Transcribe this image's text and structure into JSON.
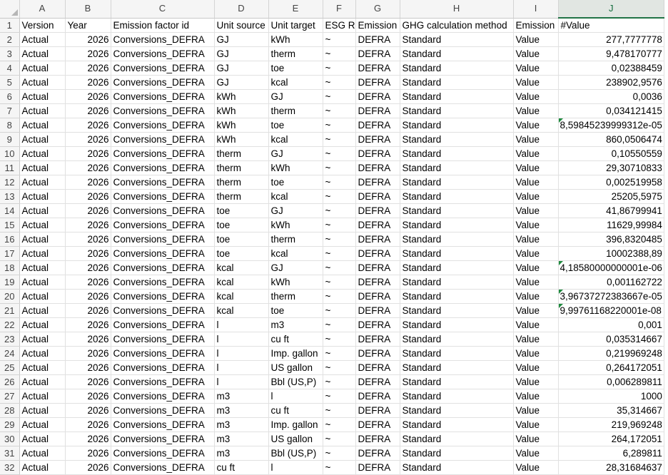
{
  "columns": [
    "A",
    "B",
    "C",
    "D",
    "E",
    "F",
    "G",
    "H",
    "I",
    "J"
  ],
  "active_column": "J",
  "rows": [
    {
      "n": "1",
      "c": [
        "Version",
        "Year",
        "Emission factor id",
        "Unit source",
        "Unit target",
        "ESG R",
        "Emission",
        "GHG calculation method",
        "Emission",
        "#Value"
      ]
    },
    {
      "n": "2",
      "c": [
        "Actual",
        "2026",
        "Conversions_DEFRA",
        "GJ",
        "kWh",
        "~",
        "DEFRA",
        "Standard",
        "Value",
        "277,7777778"
      ]
    },
    {
      "n": "3",
      "c": [
        "Actual",
        "2026",
        "Conversions_DEFRA",
        "GJ",
        "therm",
        "~",
        "DEFRA",
        "Standard",
        "Value",
        "9,478170777"
      ]
    },
    {
      "n": "4",
      "c": [
        "Actual",
        "2026",
        "Conversions_DEFRA",
        "GJ",
        "toe",
        "~",
        "DEFRA",
        "Standard",
        "Value",
        "0,02388459"
      ]
    },
    {
      "n": "5",
      "c": [
        "Actual",
        "2026",
        "Conversions_DEFRA",
        "GJ",
        "kcal",
        "~",
        "DEFRA",
        "Standard",
        "Value",
        "238902,9576"
      ]
    },
    {
      "n": "6",
      "c": [
        "Actual",
        "2026",
        "Conversions_DEFRA",
        "kWh",
        "GJ",
        "~",
        "DEFRA",
        "Standard",
        "Value",
        "0,0036"
      ]
    },
    {
      "n": "7",
      "c": [
        "Actual",
        "2026",
        "Conversions_DEFRA",
        "kWh",
        "therm",
        "~",
        "DEFRA",
        "Standard",
        "Value",
        "0,034121415"
      ]
    },
    {
      "n": "8",
      "c": [
        "Actual",
        "2026",
        "Conversions_DEFRA",
        "kWh",
        "toe",
        "~",
        "DEFRA",
        "Standard",
        "Value",
        "8,59845239999312e-05"
      ],
      "flag": true
    },
    {
      "n": "9",
      "c": [
        "Actual",
        "2026",
        "Conversions_DEFRA",
        "kWh",
        "kcal",
        "~",
        "DEFRA",
        "Standard",
        "Value",
        "860,0506474"
      ]
    },
    {
      "n": "10",
      "c": [
        "Actual",
        "2026",
        "Conversions_DEFRA",
        "therm",
        "GJ",
        "~",
        "DEFRA",
        "Standard",
        "Value",
        "0,10550559"
      ]
    },
    {
      "n": "11",
      "c": [
        "Actual",
        "2026",
        "Conversions_DEFRA",
        "therm",
        "kWh",
        "~",
        "DEFRA",
        "Standard",
        "Value",
        "29,30710833"
      ]
    },
    {
      "n": "12",
      "c": [
        "Actual",
        "2026",
        "Conversions_DEFRA",
        "therm",
        "toe",
        "~",
        "DEFRA",
        "Standard",
        "Value",
        "0,002519958"
      ]
    },
    {
      "n": "13",
      "c": [
        "Actual",
        "2026",
        "Conversions_DEFRA",
        "therm",
        "kcal",
        "~",
        "DEFRA",
        "Standard",
        "Value",
        "25205,5975"
      ]
    },
    {
      "n": "14",
      "c": [
        "Actual",
        "2026",
        "Conversions_DEFRA",
        "toe",
        "GJ",
        "~",
        "DEFRA",
        "Standard",
        "Value",
        "41,86799941"
      ]
    },
    {
      "n": "15",
      "c": [
        "Actual",
        "2026",
        "Conversions_DEFRA",
        "toe",
        "kWh",
        "~",
        "DEFRA",
        "Standard",
        "Value",
        "11629,99984"
      ]
    },
    {
      "n": "16",
      "c": [
        "Actual",
        "2026",
        "Conversions_DEFRA",
        "toe",
        "therm",
        "~",
        "DEFRA",
        "Standard",
        "Value",
        "396,8320485"
      ]
    },
    {
      "n": "17",
      "c": [
        "Actual",
        "2026",
        "Conversions_DEFRA",
        "toe",
        "kcal",
        "~",
        "DEFRA",
        "Standard",
        "Value",
        "10002388,89"
      ]
    },
    {
      "n": "18",
      "c": [
        "Actual",
        "2026",
        "Conversions_DEFRA",
        "kcal",
        "GJ",
        "~",
        "DEFRA",
        "Standard",
        "Value",
        "4,18580000000001e-06"
      ],
      "flag": true
    },
    {
      "n": "19",
      "c": [
        "Actual",
        "2026",
        "Conversions_DEFRA",
        "kcal",
        "kWh",
        "~",
        "DEFRA",
        "Standard",
        "Value",
        "0,001162722"
      ]
    },
    {
      "n": "20",
      "c": [
        "Actual",
        "2026",
        "Conversions_DEFRA",
        "kcal",
        "therm",
        "~",
        "DEFRA",
        "Standard",
        "Value",
        "3,96737272383667e-05"
      ],
      "flag": true
    },
    {
      "n": "21",
      "c": [
        "Actual",
        "2026",
        "Conversions_DEFRA",
        "kcal",
        "toe",
        "~",
        "DEFRA",
        "Standard",
        "Value",
        "9,99761168220001e-08"
      ],
      "flag": true
    },
    {
      "n": "22",
      "c": [
        "Actual",
        "2026",
        "Conversions_DEFRA",
        "l",
        "m3",
        "~",
        "DEFRA",
        "Standard",
        "Value",
        "0,001"
      ]
    },
    {
      "n": "23",
      "c": [
        "Actual",
        "2026",
        "Conversions_DEFRA",
        "l",
        "cu ft",
        "~",
        "DEFRA",
        "Standard",
        "Value",
        "0,035314667"
      ]
    },
    {
      "n": "24",
      "c": [
        "Actual",
        "2026",
        "Conversions_DEFRA",
        "l",
        "Imp. gallon",
        "~",
        "DEFRA",
        "Standard",
        "Value",
        "0,219969248"
      ]
    },
    {
      "n": "25",
      "c": [
        "Actual",
        "2026",
        "Conversions_DEFRA",
        "l",
        "US gallon",
        "~",
        "DEFRA",
        "Standard",
        "Value",
        "0,264172051"
      ]
    },
    {
      "n": "26",
      "c": [
        "Actual",
        "2026",
        "Conversions_DEFRA",
        "l",
        "Bbl (US,P)",
        "~",
        "DEFRA",
        "Standard",
        "Value",
        "0,006289811"
      ]
    },
    {
      "n": "27",
      "c": [
        "Actual",
        "2026",
        "Conversions_DEFRA",
        "m3",
        "l",
        "~",
        "DEFRA",
        "Standard",
        "Value",
        "1000"
      ]
    },
    {
      "n": "28",
      "c": [
        "Actual",
        "2026",
        "Conversions_DEFRA",
        "m3",
        "cu ft",
        "~",
        "DEFRA",
        "Standard",
        "Value",
        "35,314667"
      ]
    },
    {
      "n": "29",
      "c": [
        "Actual",
        "2026",
        "Conversions_DEFRA",
        "m3",
        "Imp. gallon",
        "~",
        "DEFRA",
        "Standard",
        "Value",
        "219,969248"
      ]
    },
    {
      "n": "30",
      "c": [
        "Actual",
        "2026",
        "Conversions_DEFRA",
        "m3",
        "US gallon",
        "~",
        "DEFRA",
        "Standard",
        "Value",
        "264,172051"
      ]
    },
    {
      "n": "31",
      "c": [
        "Actual",
        "2026",
        "Conversions_DEFRA",
        "m3",
        "Bbl (US,P)",
        "~",
        "DEFRA",
        "Standard",
        "Value",
        "6,289811"
      ]
    },
    {
      "n": "32",
      "c": [
        "Actual",
        "2026",
        "Conversions_DEFRA",
        "cu ft",
        "l",
        "~",
        "DEFRA",
        "Standard",
        "Value",
        "28,31684637"
      ]
    }
  ]
}
